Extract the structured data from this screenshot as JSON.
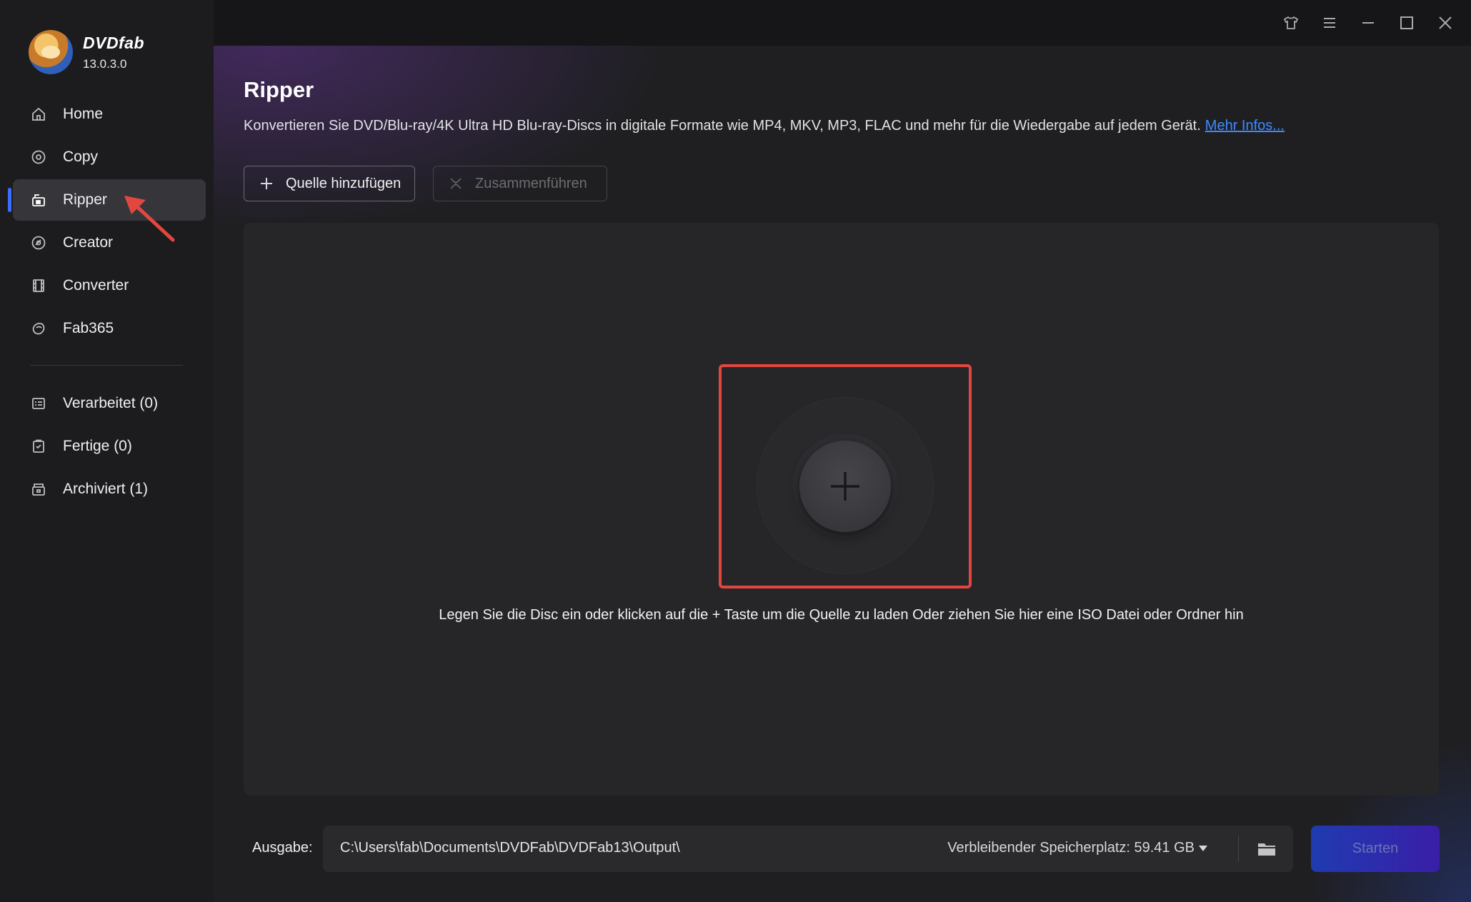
{
  "app": {
    "name": "DVDfab",
    "version": "13.0.3.0"
  },
  "sidebar": {
    "items": [
      {
        "label": "Home",
        "icon": "home-icon"
      },
      {
        "label": "Copy",
        "icon": "copy-icon"
      },
      {
        "label": "Ripper",
        "icon": "ripper-icon",
        "active": true
      },
      {
        "label": "Creator",
        "icon": "creator-icon"
      },
      {
        "label": "Converter",
        "icon": "converter-icon"
      },
      {
        "label": "Fab365",
        "icon": "fab365-icon"
      }
    ],
    "queue": [
      {
        "label": "Verarbeitet (0)",
        "icon": "processing-icon"
      },
      {
        "label": "Fertige (0)",
        "icon": "finished-icon"
      },
      {
        "label": "Archiviert (1)",
        "icon": "archive-icon"
      }
    ]
  },
  "titlebar": {
    "icons": [
      "shirt-icon",
      "menu-icon",
      "minimize-icon",
      "maximize-icon",
      "close-icon"
    ]
  },
  "main": {
    "title": "Ripper",
    "description": "Konvertieren Sie DVD/Blu-ray/4K Ultra HD Blu-ray-Discs in digitale Formate wie MP4, MKV, MP3, FLAC und mehr für die Wiedergabe auf jedem Gerät.",
    "more_link": "Mehr Infos...",
    "add_source_label": "Quelle hinzufügen",
    "merge_label": "Zusammenführen",
    "drop_hint": "Legen Sie die Disc ein oder klicken auf die + Taste um die Quelle zu laden Oder ziehen Sie hier eine ISO Datei oder Ordner hin"
  },
  "output": {
    "label": "Ausgabe:",
    "path": "C:\\Users\\fab\\Documents\\DVDFab\\DVDFab13\\Output\\",
    "free_space": "Verbleibender Speicherplatz: 59.41 GB",
    "start_label": "Starten"
  },
  "colors": {
    "accent": "#3b6cff",
    "highlight": "#e2473f",
    "link": "#3d8bff"
  }
}
